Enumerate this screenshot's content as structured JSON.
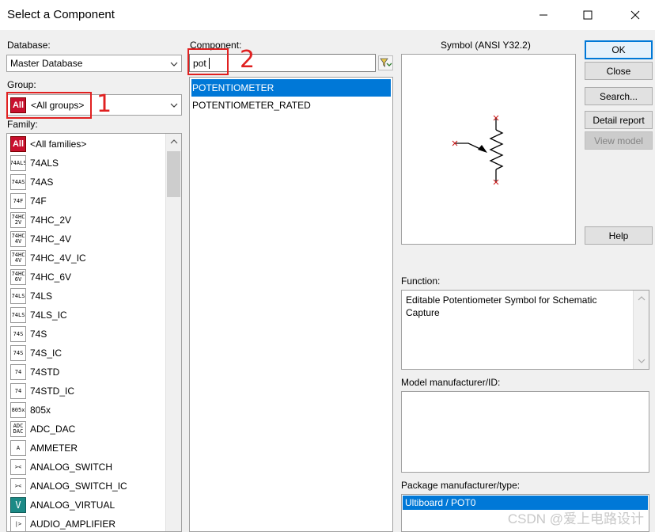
{
  "window": {
    "title": "Select a Component"
  },
  "database": {
    "label": "Database:",
    "value": "Master Database"
  },
  "group": {
    "label": "Group:",
    "icon_text": "All",
    "value": "<All groups>"
  },
  "family": {
    "label": "Family:",
    "items": [
      {
        "icon_text": "All",
        "label": "<All families>",
        "icon": "all-families-icon"
      },
      {
        "icon_text": "74ALS",
        "label": "74ALS",
        "icon": "74als-gate-icon"
      },
      {
        "icon_text": "74AS",
        "label": "74AS",
        "icon": "74as-gate-icon"
      },
      {
        "icon_text": "74F",
        "label": "74F",
        "icon": "74f-gate-icon"
      },
      {
        "icon_text": "74HC 2V",
        "label": "74HC_2V",
        "icon": "74hc-2v-gate-icon"
      },
      {
        "icon_text": "74HC 4V",
        "label": "74HC_4V",
        "icon": "74hc-4v-gate-icon"
      },
      {
        "icon_text": "74HC 4V",
        "label": "74HC_4V_IC",
        "icon": "74hc-4v-ic-gate-icon"
      },
      {
        "icon_text": "74HC 6V",
        "label": "74HC_6V",
        "icon": "74hc-6v-gate-icon"
      },
      {
        "icon_text": "74LS",
        "label": "74LS",
        "icon": "74ls-gate-icon"
      },
      {
        "icon_text": "74LS",
        "label": "74LS_IC",
        "icon": "74ls-ic-gate-icon"
      },
      {
        "icon_text": "74S",
        "label": "74S",
        "icon": "74s-gate-icon"
      },
      {
        "icon_text": "74S",
        "label": "74S_IC",
        "icon": "74s-ic-gate-icon"
      },
      {
        "icon_text": "74",
        "label": "74STD",
        "icon": "74std-gate-icon"
      },
      {
        "icon_text": "74",
        "label": "74STD_IC",
        "icon": "74std-ic-gate-icon"
      },
      {
        "icon_text": "805x",
        "label": "805x",
        "icon": "805x-chip-icon"
      },
      {
        "icon_text": "ADC DAC",
        "label": "ADC_DAC",
        "icon": "adc-dac-icon"
      },
      {
        "icon_text": "A",
        "label": "AMMETER",
        "icon": "ammeter-icon"
      },
      {
        "icon_text": "><",
        "label": "ANALOG_SWITCH",
        "icon": "analog-switch-icon"
      },
      {
        "icon_text": "><",
        "label": "ANALOG_SWITCH_IC",
        "icon": "analog-switch-ic-icon"
      },
      {
        "icon_text": "V",
        "label": "ANALOG_VIRTUAL",
        "icon": "analog-virtual-icon"
      },
      {
        "icon_text": "|>",
        "label": "AUDIO_AMPLIFIER",
        "icon": "audio-amplifier-icon"
      }
    ]
  },
  "component": {
    "label": "Component:",
    "search_value": "pot",
    "results": [
      {
        "label": "POTENTIOMETER",
        "selected": true
      },
      {
        "label": "POTENTIOMETER_RATED",
        "selected": false
      }
    ]
  },
  "symbol": {
    "label": "Symbol (ANSI Y32.2)"
  },
  "buttons": {
    "ok": "OK",
    "close": "Close",
    "search": "Search...",
    "detail_report": "Detail report",
    "view_model": "View model",
    "help": "Help"
  },
  "function": {
    "label": "Function:",
    "text": "Editable Potentiometer Symbol for Schematic Capture"
  },
  "model_manufacturer": {
    "label": "Model manufacturer/ID:"
  },
  "package": {
    "label": "Package manufacturer/type:",
    "selected": "Ultiboard / POT0"
  },
  "annotations": {
    "num1": "1",
    "num2": "2"
  },
  "watermark": "CSDN @爱上电路设计",
  "colors": {
    "selection": "#0078d7",
    "annotation": "#e02020",
    "all_icon": "#c8102e"
  }
}
